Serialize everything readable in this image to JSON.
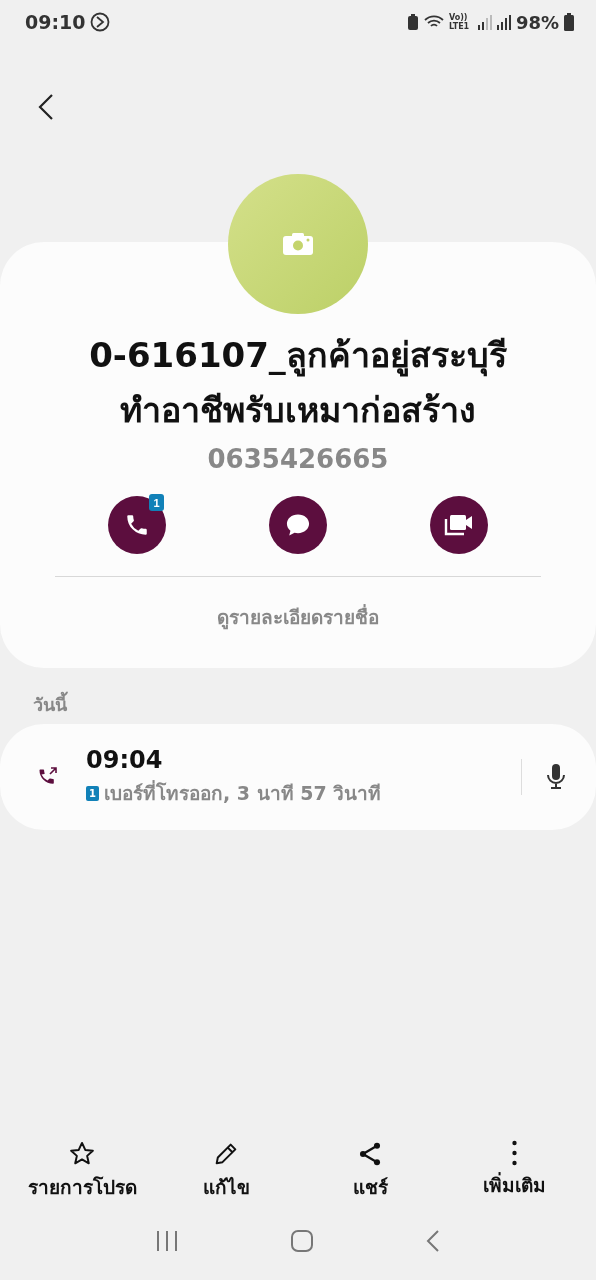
{
  "status_bar": {
    "time": "09:10",
    "battery": "98%",
    "network": "Vo)) LTE1"
  },
  "contact": {
    "name_lines": [
      "0-616107_ลูกค้าอยู่สระบุรี",
      "ทำอาชีพรับเหมาก่อสร้าง"
    ],
    "number": "0635426665",
    "actions": [
      {
        "kind": "call",
        "badge": "1"
      },
      {
        "kind": "message"
      },
      {
        "kind": "video"
      }
    ],
    "details_link": "ดูรายละเอียดรายชื่อ"
  },
  "history": {
    "heading": "วันนี้",
    "entries": [
      {
        "kind": "outgoing",
        "time": "09:04",
        "sim": "1",
        "detail": "เบอร์ที่โทรออก, 3 นาที 57 วินาที"
      }
    ]
  },
  "bottom_bar": [
    {
      "kind": "star",
      "label": "รายการโปรด"
    },
    {
      "kind": "edit",
      "label": "แก้ไข"
    },
    {
      "kind": "share",
      "label": "แชร์"
    },
    {
      "kind": "more",
      "label": "เพิ่มเติม"
    }
  ]
}
